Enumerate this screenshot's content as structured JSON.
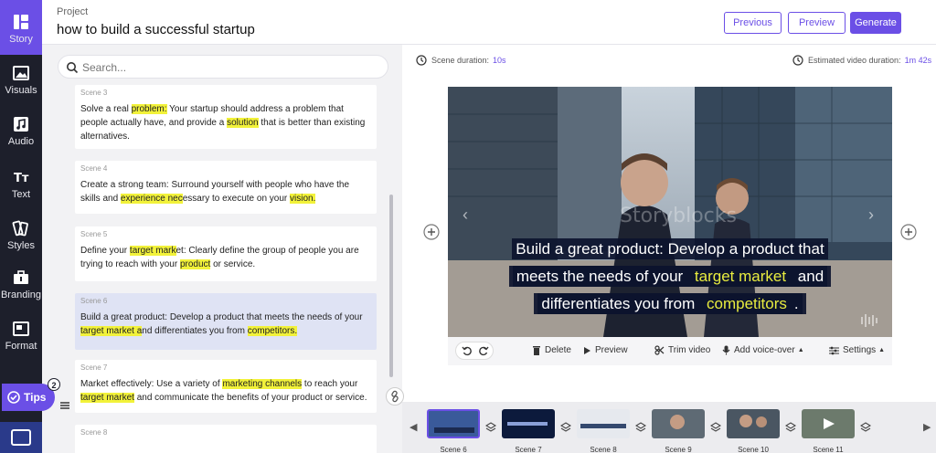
{
  "sidebar": {
    "items": [
      {
        "label": "Story",
        "icon": "story-icon"
      },
      {
        "label": "Visuals",
        "icon": "image-icon"
      },
      {
        "label": "Audio",
        "icon": "music-note-icon"
      },
      {
        "label": "Text",
        "icon": "text-icon"
      },
      {
        "label": "Styles",
        "icon": "styles-icon"
      },
      {
        "label": "Branding",
        "icon": "briefcase-icon"
      },
      {
        "label": "Format",
        "icon": "format-icon"
      }
    ],
    "tips_label": "Tips",
    "tips_badge": "2"
  },
  "header": {
    "project_label": "Project",
    "project_title": "how to build a successful startup",
    "previous_label": "Previous",
    "preview_label": "Preview",
    "generate_label": "Generate"
  },
  "search": {
    "placeholder": "Search..."
  },
  "scenes": [
    {
      "name": "Scene 3",
      "text": "Solve a real problem: Your startup should address a problem that people actually have, and provide a solution that is better than existing alternatives."
    },
    {
      "name": "Scene 4",
      "text": "Create a strong team: Surround yourself with people who have the skills and experience necessary to execute on your vision."
    },
    {
      "name": "Scene 5",
      "text": "Define your target market: Clearly define the group of people you are trying to reach with your product or service."
    },
    {
      "name": "Scene 6",
      "text": "Build a great product: Develop a product that meets the needs of your target market and differentiates you from competitors."
    },
    {
      "name": "Scene 7",
      "text": "Market effectively: Use a variety of marketing channels to reach your target market and communicate the benefits of your product or service."
    },
    {
      "name": "Scene 8",
      "text": ""
    }
  ],
  "editor": {
    "scene_duration_label": "Scene duration:",
    "scene_duration_value": "10s",
    "est_duration_label": "Estimated video duration:",
    "est_duration_value": "1m 42s",
    "caption_lines": [
      [
        "Build a great product: Develop a product that"
      ],
      [
        "meets the needs of your ",
        "target market",
        " and"
      ],
      [
        "differentiates you from ",
        "competitors",
        "."
      ]
    ],
    "watermark": "Storyblocks",
    "accent": "#6b4fe6"
  },
  "toolbar": {
    "delete_label": "Delete",
    "preview_label": "Preview",
    "trim_label": "Trim video",
    "voiceover_label": "Add voice-over",
    "settings_label": "Settings"
  },
  "timeline": {
    "scenes": [
      "Scene 6",
      "Scene 7",
      "Scene 8",
      "Scene 9",
      "Scene 10",
      "Scene 11"
    ],
    "selected_index": 0
  }
}
